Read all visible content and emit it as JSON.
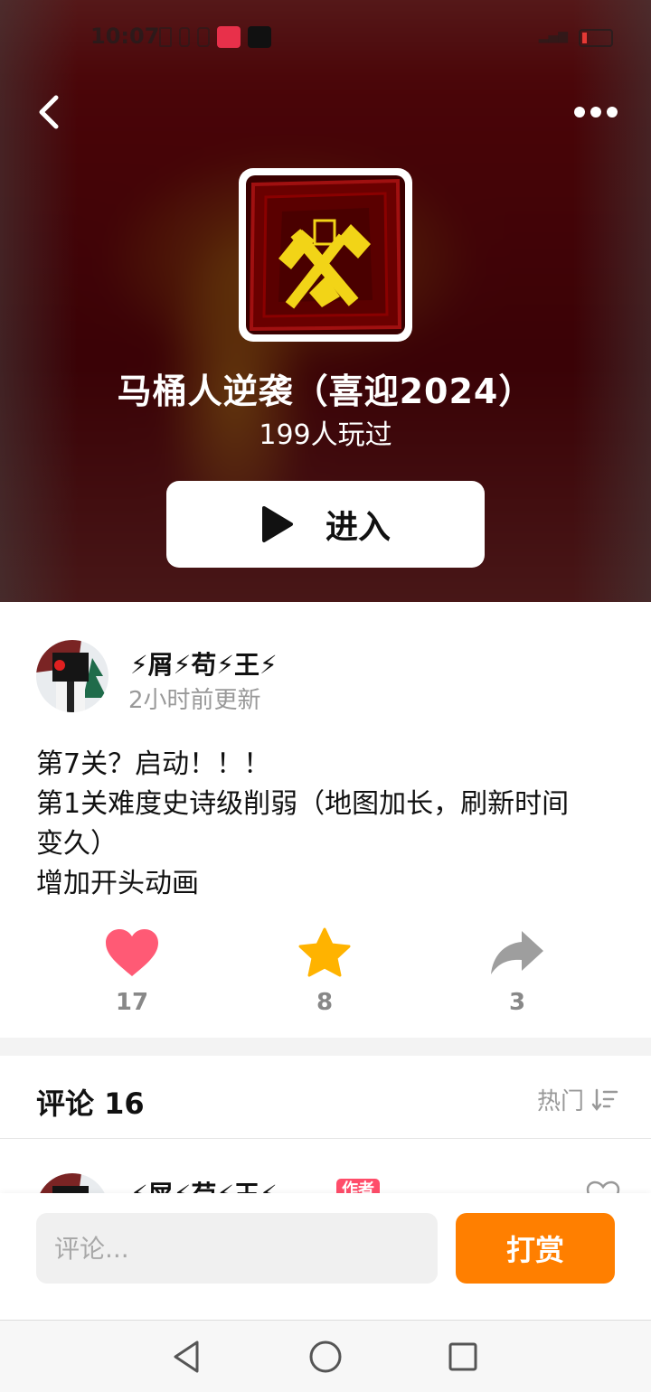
{
  "status_bar": {
    "time": "10:07"
  },
  "game": {
    "title": "马桶人逆袭（喜迎2024）",
    "play_count": "199人玩过",
    "enter_label": "进入"
  },
  "post": {
    "author": "⚡屑⚡苟⚡王⚡",
    "updated": "2小时前更新",
    "lines": [
      "第7关？启动！！！",
      "第1关难度史诗级削弱（地图加长，刷新时间",
      "变久）",
      "增加开头动画"
    ],
    "actions": {
      "likes": "17",
      "favorites": "8",
      "shares": "3"
    }
  },
  "comments": {
    "title": "评论 16",
    "sort_label": "热门",
    "first": {
      "author": "⚡屑⚡苟⚡王⚡",
      "badge": "作者"
    }
  },
  "bottom_bar": {
    "input_placeholder": "评论...",
    "tip_label": "打赏"
  },
  "colors": {
    "accent": "#ff7f00",
    "like": "#ff5a75",
    "favorite": "#ffb300",
    "share": "#9e9e9e",
    "author_badge": "#ff4d6a"
  },
  "icons": {
    "back": "chevron-left-icon",
    "more": "more-dots-icon",
    "play": "play-icon",
    "like": "heart-icon",
    "favorite": "star-icon",
    "share": "share-arrow-icon",
    "sort": "sort-icon"
  }
}
